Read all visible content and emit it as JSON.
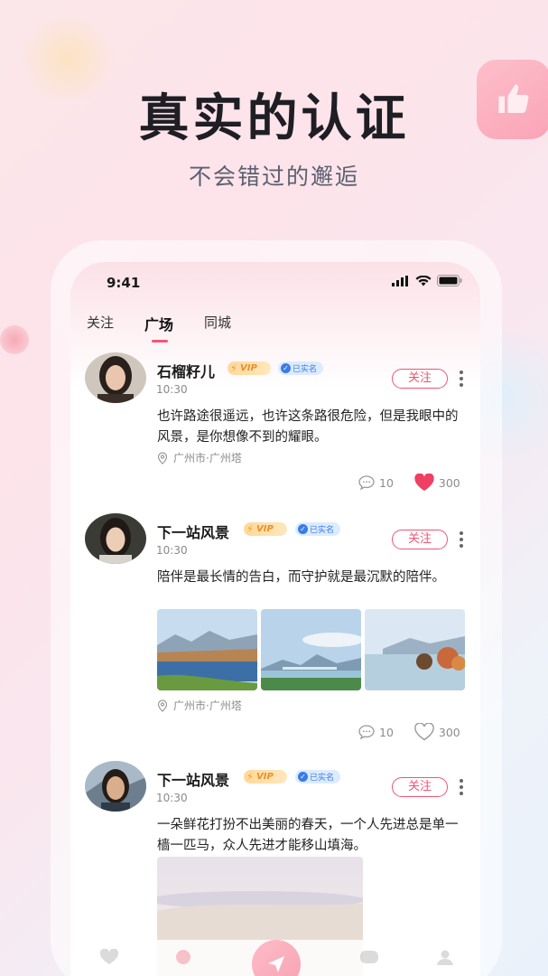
{
  "hero": {
    "title": "真实的认证",
    "subtitle": "不会错过的邂逅"
  },
  "status": {
    "time": "9:41"
  },
  "tabs": [
    {
      "label": "关注",
      "active": false
    },
    {
      "label": "广场",
      "active": true
    },
    {
      "label": "同城",
      "active": false
    }
  ],
  "posts": [
    {
      "username": "石榴籽儿",
      "vip": "VIP",
      "verified": "已实名",
      "time": "10:30",
      "follow": "关注",
      "text": "也许路途很遥远，也许这条路很危险，但是我眼中的风景，是你想像不到的耀眼。",
      "location": "广州市·广州塔",
      "comments": "10",
      "likes": "300",
      "liked": true
    },
    {
      "username": "下一站风景",
      "vip": "VIP",
      "verified": "已实名",
      "time": "10:30",
      "follow": "关注",
      "text": "陪伴是最长情的告白，而守护就是最沉默的陪伴。",
      "location": "广州市·广州塔",
      "comments": "10",
      "likes": "300",
      "liked": false
    },
    {
      "username": "下一站风景",
      "vip": "VIP",
      "verified": "已实名",
      "time": "10:30",
      "follow": "关注",
      "text": "一朵鲜花打扮不出美丽的春天，一个人先进总是单一樯一匹马，众人先进才能移山填海。"
    }
  ],
  "colors": {
    "accent": "#ee5573",
    "verified": "#3a7be6",
    "vip": "#f29a1c"
  }
}
